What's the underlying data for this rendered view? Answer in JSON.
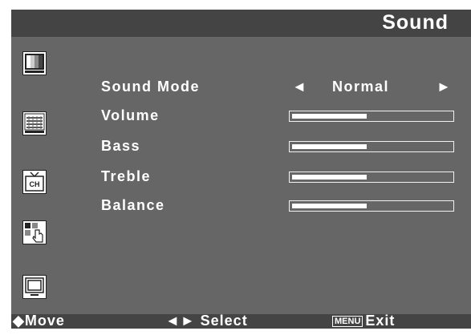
{
  "title": "Sound",
  "items": [
    {
      "label": "Sound Mode"
    },
    {
      "label": "Volume",
      "level": 0.47
    },
    {
      "label": "Bass",
      "level": 0.47
    },
    {
      "label": "Treble",
      "level": 0.47
    },
    {
      "label": "Balance",
      "level": 0.47
    }
  ],
  "sound_mode_value": "Normal",
  "arrows": {
    "left": "◄",
    "right": "►"
  },
  "hints": {
    "move_glyph": "◆",
    "move_label": "Move",
    "select_glyph": "◄►",
    "select_label": "Select",
    "menu_key": "MENU",
    "exit_label": "Exit"
  },
  "icons": [
    "picture-icon",
    "sound-icon",
    "channel-icon",
    "setup-icon",
    "screen-icon"
  ],
  "colors": {
    "header": "#444444",
    "panel": "#666666",
    "text": "#ffffff"
  }
}
